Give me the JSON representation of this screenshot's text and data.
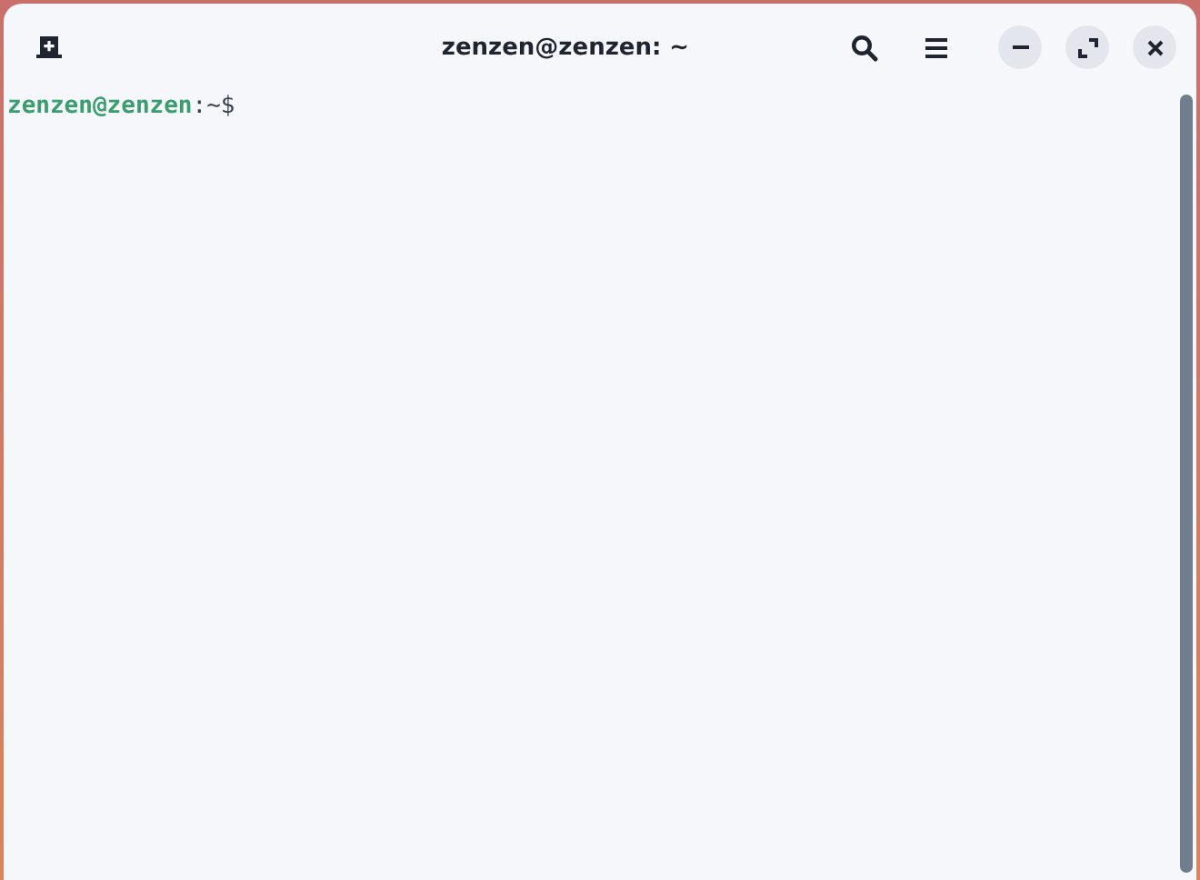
{
  "window": {
    "title": "zenzen@zenzen: ~"
  },
  "terminal": {
    "prompt_user": "zenzen@zenzen",
    "prompt_path": ":~$"
  }
}
